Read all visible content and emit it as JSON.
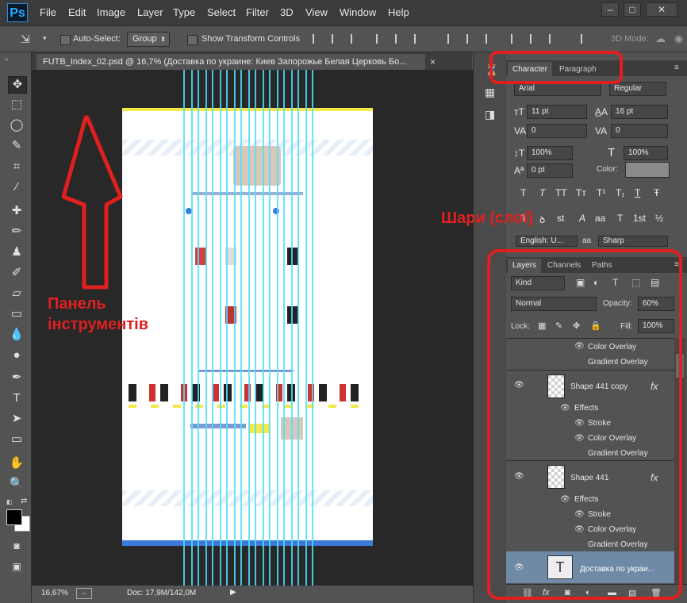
{
  "app": {
    "logo": "Ps"
  },
  "menu": [
    "File",
    "Edit",
    "Image",
    "Layer",
    "Type",
    "Select",
    "Filter",
    "3D",
    "View",
    "Window",
    "Help"
  ],
  "window_controls": [
    "–",
    "□",
    "✕"
  ],
  "options": {
    "auto_select_label": "Auto-Select:",
    "group_value": "Group",
    "show_transform_label": "Show Transform Controls",
    "mode_3d_label": "3D Mode:"
  },
  "document": {
    "tab_title": "FUTB_Index_02.psd @ 16,7% (Доставка по украине: Киев Запорожье Белая Церковь Бо...",
    "tab_close": "×",
    "zoom": "16,67%",
    "doc_size": "Doc: 17,9M/142,0M"
  },
  "character_panel": {
    "tabs": [
      "Character",
      "Paragraph"
    ],
    "font_family": "Arial",
    "font_style": "Regular",
    "size": "11 pt",
    "leading": "16 pt",
    "kerning": "0",
    "tracking": "0",
    "vertical_scale": "100%",
    "horizontal_scale": "100%",
    "baseline_shift": "0 pt",
    "color_label": "Color:",
    "color_value": "#8a8a8a",
    "type_buttons": [
      "T",
      "T",
      "TT",
      "Tт",
      "T¹",
      "T₁",
      "T",
      "Ŧ"
    ],
    "opentype_buttons": [
      "fi",
      "ꝺ",
      "st",
      "A",
      "aa",
      "T",
      "1st",
      "½"
    ],
    "language": "English: U...",
    "aa_icon": "aa",
    "antialias": "Sharp"
  },
  "layers_panel": {
    "tabs": [
      "Layers",
      "Channels",
      "Paths"
    ],
    "filter": "Kind",
    "blend_mode": "Normal",
    "opacity_label": "Opacity:",
    "opacity_value": "60%",
    "lock_label": "Lock:",
    "fill_label": "Fill:",
    "fill_value": "100%",
    "rows": [
      {
        "type": "effect",
        "label": "Color Overlay"
      },
      {
        "type": "effect",
        "label": "Gradient Overlay"
      },
      {
        "type": "layer",
        "label": "Shape 441 copy",
        "fx": "fx"
      },
      {
        "type": "effects",
        "label": "Effects"
      },
      {
        "type": "effect",
        "label": "Stroke"
      },
      {
        "type": "effect",
        "label": "Color Overlay"
      },
      {
        "type": "effect",
        "label": "Gradient Overlay"
      },
      {
        "type": "layer",
        "label": "Shape 441",
        "fx": "fx"
      },
      {
        "type": "effects",
        "label": "Effects"
      },
      {
        "type": "effect",
        "label": "Stroke"
      },
      {
        "type": "effect",
        "label": "Color Overlay"
      },
      {
        "type": "effect",
        "label": "Gradient Overlay"
      },
      {
        "type": "text-layer",
        "label": "Доставка по украи..."
      }
    ],
    "bottom_icons": [
      "link-icon",
      "fx-icon",
      "mask-icon",
      "adjustment-icon",
      "folder-icon",
      "new-layer-icon",
      "trash-icon"
    ]
  },
  "annotations": {
    "tools_panel": "Панель\nінструментів",
    "layers": "Шари (слої)"
  },
  "colors": {
    "annotation_red": "#e02020",
    "guide": "#4fe0ff",
    "selected_layer": "#6f8aa6"
  }
}
